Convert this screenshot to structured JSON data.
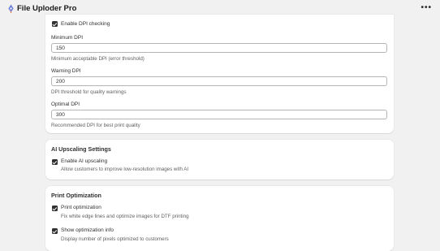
{
  "app": {
    "title": "File Uploder Pro",
    "icon": "pen-nib-icon",
    "menu_icon": "ellipsis-icon",
    "menu_label": "•••"
  },
  "dpi_settings": {
    "enable_label": "Enable DPI checking",
    "enable_checked": true,
    "fields": [
      {
        "label": "Minimum DPI",
        "value": "150",
        "help": "Minimum acceptable DPI (error threshold)"
      },
      {
        "label": "Warning DPI",
        "value": "200",
        "help": "DPI threshold for quality warnings"
      },
      {
        "label": "Optimal DPI",
        "value": "300",
        "help": "Recommended DPI for best print quality"
      }
    ]
  },
  "ai_upscaling": {
    "title": "AI Upscaling Settings",
    "enable_label": "Enable AI upscaling",
    "enable_checked": true,
    "enable_help": "Allow customers to improve low-resolution images with AI"
  },
  "print_optimization": {
    "title": "Print Optimization",
    "options": [
      {
        "label": "Print optimization",
        "checked": true,
        "help": "Fix white edge lines and optimize images for DTF printing"
      },
      {
        "label": "Show optimization info",
        "checked": true,
        "help": "Display number of pixels optimized to customers"
      }
    ]
  },
  "colors": {
    "background": "#f1f1f1",
    "card": "#ffffff",
    "checkbox": "#303030",
    "help_text": "#616161"
  }
}
